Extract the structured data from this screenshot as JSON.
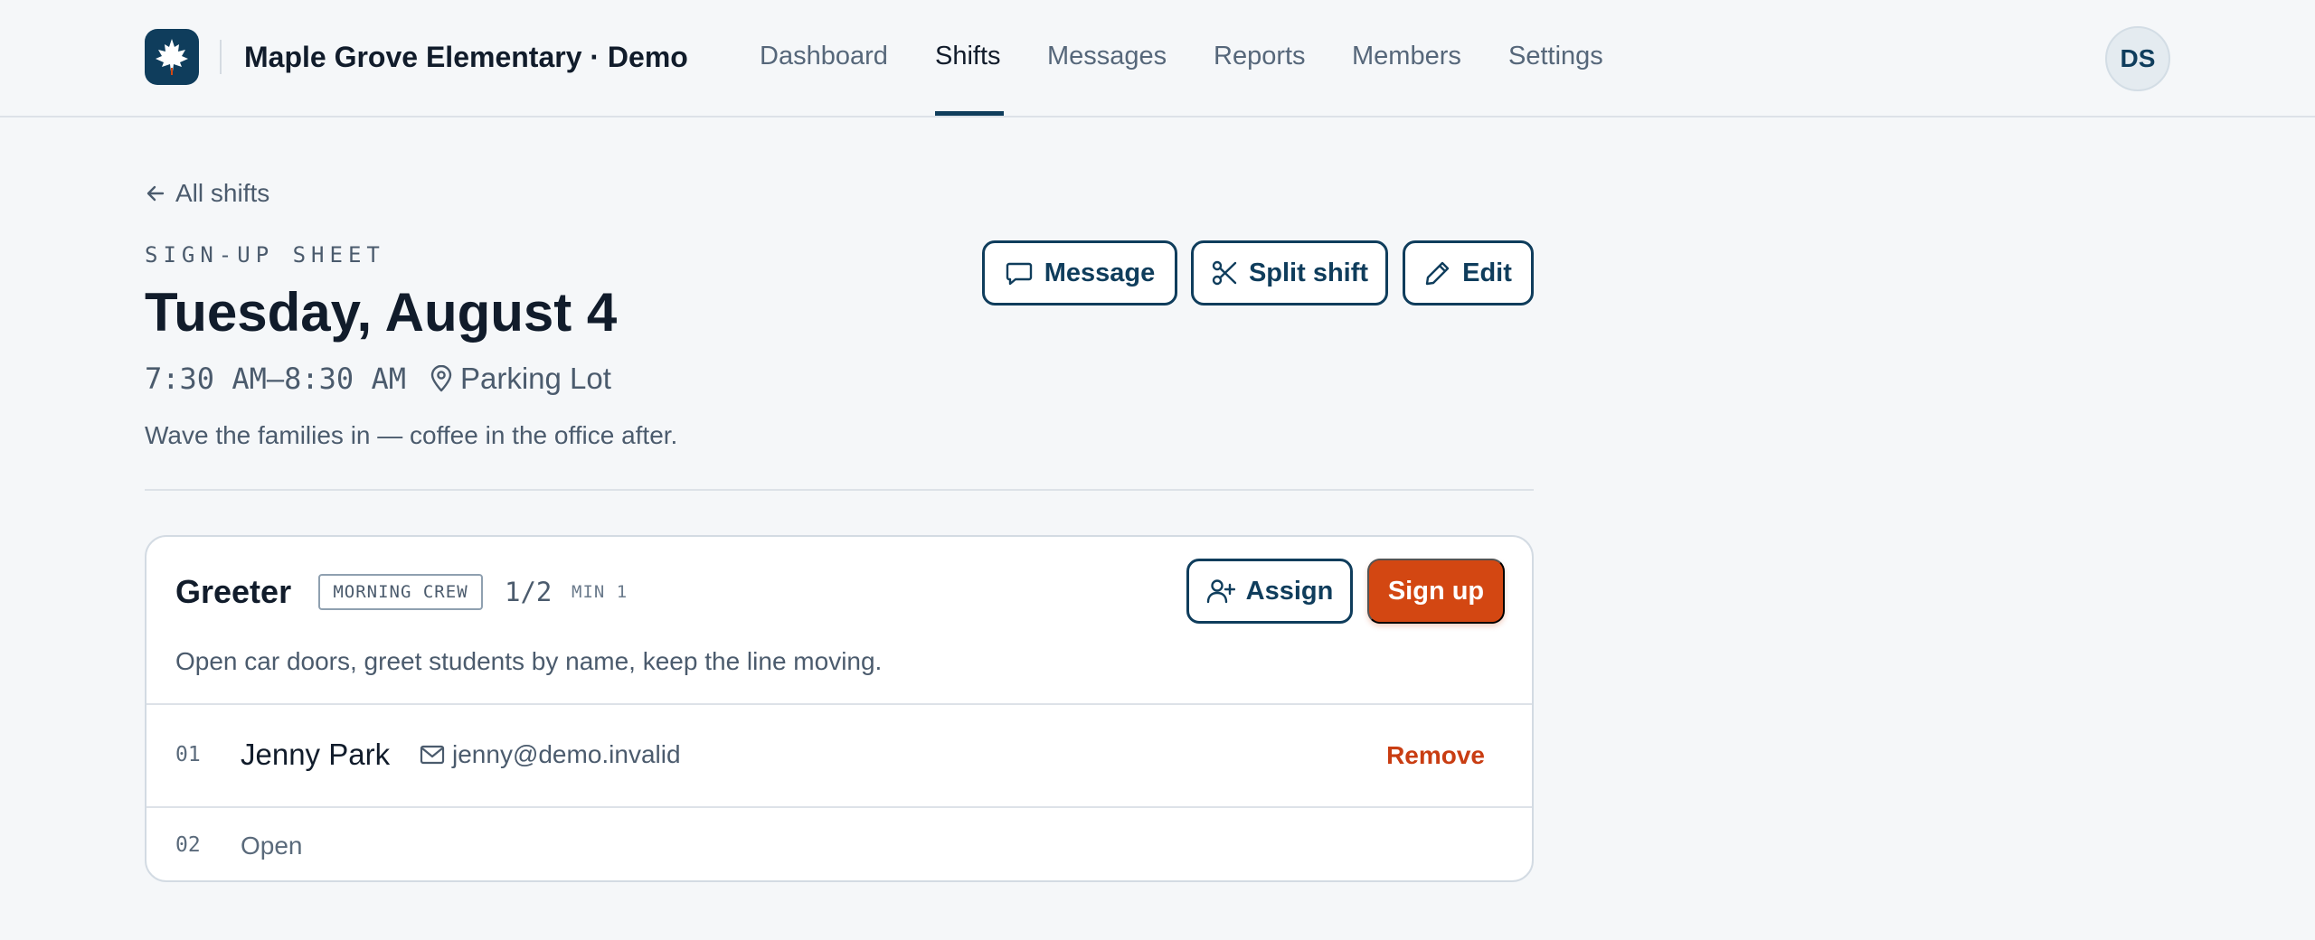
{
  "header": {
    "org_name": "Maple Grove Elementary · Demo",
    "nav": [
      {
        "label": "Dashboard",
        "active": false
      },
      {
        "label": "Shifts",
        "active": true
      },
      {
        "label": "Messages",
        "active": false
      },
      {
        "label": "Reports",
        "active": false
      },
      {
        "label": "Members",
        "active": false
      },
      {
        "label": "Settings",
        "active": false
      }
    ],
    "user_initials": "DS",
    "logo_icon": "maple-leaf-icon",
    "brand_color": "#0f3d5c"
  },
  "page": {
    "back_label": "All shifts",
    "eyebrow": "SIGN-UP SHEET",
    "title": "Tuesday, August 4",
    "time": "7:30 AM–8:30 AM",
    "location": "Parking Lot",
    "description": "Wave the families in — coffee in the office after.",
    "actions": {
      "message": "Message",
      "split": "Split shift",
      "edit": "Edit"
    }
  },
  "role": {
    "name": "Greeter",
    "tag": "MORNING CREW",
    "count": "1/2",
    "min": "MIN 1",
    "description": "Open car doors, greet students by name, keep the line moving.",
    "assign_label": "Assign",
    "signup_label": "Sign up",
    "accent_color": "#d34712",
    "slots": [
      {
        "number": "01",
        "name": "Jenny Park",
        "email": "jenny@demo.invalid",
        "action": "Remove"
      },
      {
        "number": "02",
        "status": "Open"
      }
    ]
  }
}
